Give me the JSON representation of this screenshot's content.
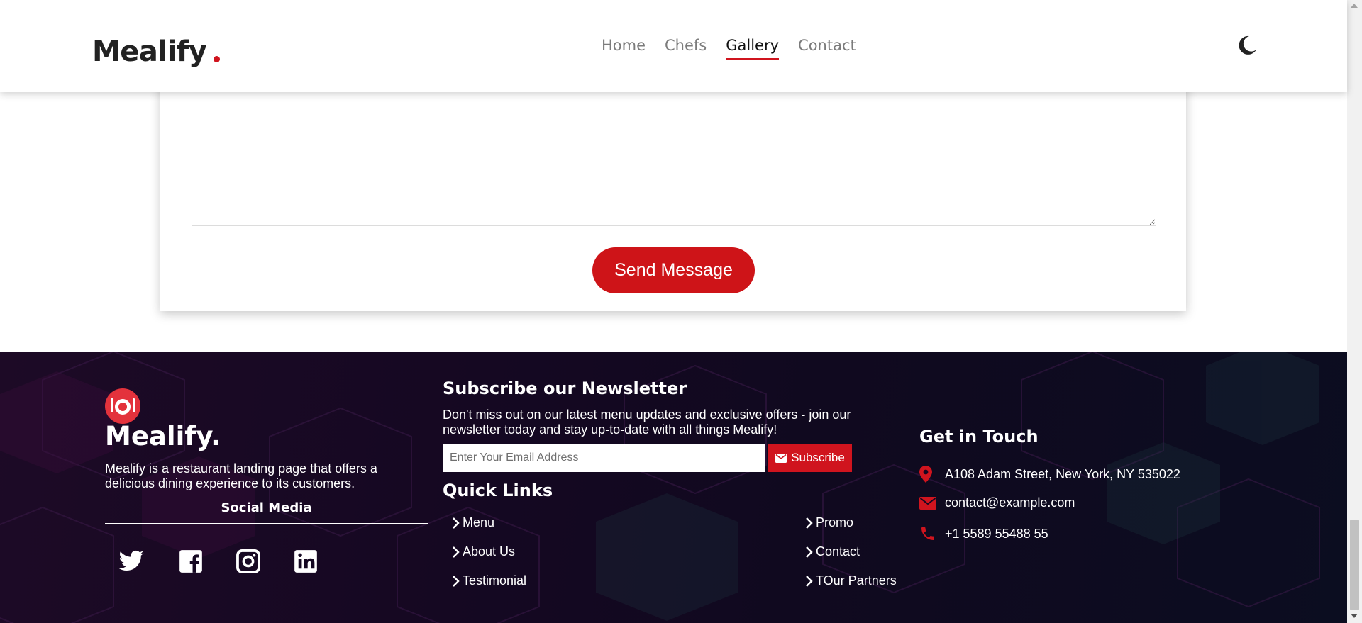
{
  "header": {
    "brand": "Mealify",
    "nav": [
      {
        "label": "Home",
        "active": false
      },
      {
        "label": "Chefs",
        "active": false
      },
      {
        "label": "Gallery",
        "active": true
      },
      {
        "label": "Contact",
        "active": false
      }
    ],
    "theme_icon": "moon-icon"
  },
  "form": {
    "message_value": "",
    "send_label": "Send Message"
  },
  "footer": {
    "brand": "Mealify.",
    "description": "Mealify is a restaurant landing page that offers a delicious dining experience to its customers.",
    "social_title": "Social Media",
    "social": [
      "twitter-icon",
      "facebook-icon",
      "instagram-icon",
      "linkedin-icon"
    ],
    "newsletter": {
      "title": "Subscribe our Newsletter",
      "description": "Don't miss out on our latest menu updates and exclusive offers - join our newsletter today and stay up-to-date with all things Mealify!",
      "placeholder": "Enter Your Email Address",
      "button_label": "Subscribe"
    },
    "quick_links": {
      "title": "Quick Links",
      "items": [
        "Menu",
        "About Us",
        "Testimonial",
        "Promo",
        "Contact",
        "TOur Partners"
      ]
    },
    "contact": {
      "title": "Get in Touch",
      "address": "A108 Adam Street, New York, NY 535022",
      "email": "contact@example.com",
      "phone": "+1 5589 55488 55"
    }
  },
  "colors": {
    "accent": "#d0141e",
    "footer_bg": "#150822"
  }
}
